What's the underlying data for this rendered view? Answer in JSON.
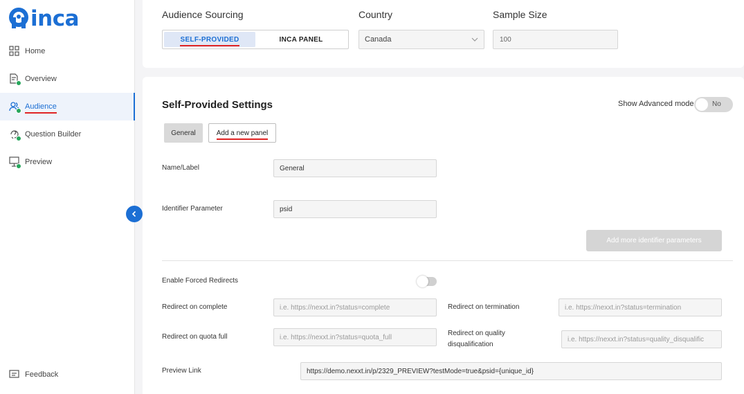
{
  "brand": {
    "name": "inca",
    "color": "#1c6fd4"
  },
  "sidebar": {
    "items": [
      {
        "label": "Home",
        "icon": "grid-icon"
      },
      {
        "label": "Overview",
        "icon": "document-check-icon"
      },
      {
        "label": "Audience",
        "icon": "users-icon",
        "active": true
      },
      {
        "label": "Question Builder",
        "icon": "question-check-icon"
      },
      {
        "label": "Preview",
        "icon": "presentation-icon"
      }
    ],
    "feedback_label": "Feedback"
  },
  "sourcing": {
    "label": "Audience Sourcing",
    "options": [
      "SELF-PROVIDED",
      "INCA PANEL"
    ],
    "selected": "SELF-PROVIDED"
  },
  "country": {
    "label": "Country",
    "value": "Canada"
  },
  "sample_size": {
    "label": "Sample Size",
    "value": "100"
  },
  "settings": {
    "title": "Self-Provided Settings",
    "advanced_label": "Show Advanced mode",
    "advanced_value": "No",
    "tabs": [
      "General",
      "Add a new panel"
    ],
    "name_label": "Name/Label",
    "name_value": "General",
    "identifier_label": "Identifier Parameter",
    "identifier_value": "psid",
    "add_identifier_label": "Add more identifier parameters",
    "forced_redirects_label": "Enable Forced Redirects",
    "redirect_complete_label": "Redirect on complete",
    "redirect_complete_placeholder": "i.e. https://nexxt.in?status=complete",
    "redirect_termination_label": "Redirect on termination",
    "redirect_termination_placeholder": "i.e. https://nexxt.in?status=termination",
    "redirect_quota_label": "Redirect on quota full",
    "redirect_quota_placeholder": "i.e. https://nexxt.in?status=quota_full",
    "redirect_quality_label_1": "Redirect on quality",
    "redirect_quality_label_2": "disqualification",
    "redirect_quality_placeholder": "i.e. https://nexxt.in?status=quality_disqualific",
    "preview_label": "Preview Link",
    "preview_value": "https://demo.nexxt.in/p/2329_PREVIEW?testMode=true&psid={unique_id}"
  }
}
